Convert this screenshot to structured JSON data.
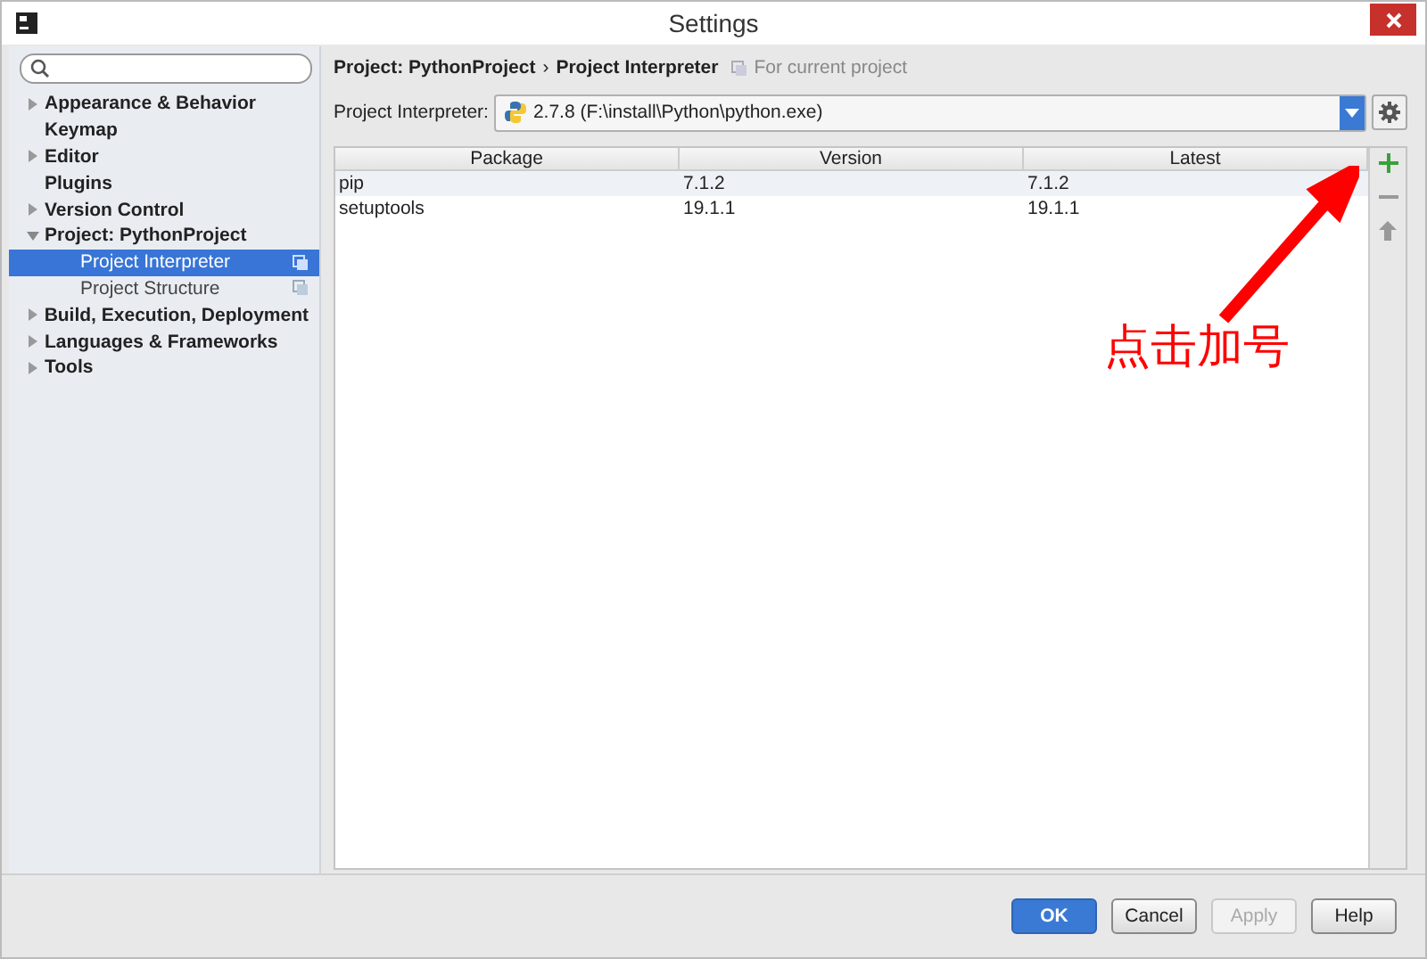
{
  "window": {
    "title": "Settings"
  },
  "sidebar": {
    "items": [
      {
        "label": "Appearance & Behavior",
        "kind": "group",
        "expanded": false,
        "selected": false
      },
      {
        "label": "Keymap",
        "kind": "page",
        "selected": false
      },
      {
        "label": "Editor",
        "kind": "group",
        "expanded": false,
        "selected": false
      },
      {
        "label": "Plugins",
        "kind": "page",
        "selected": false
      },
      {
        "label": "Version Control",
        "kind": "group",
        "expanded": false,
        "selected": false
      },
      {
        "label": "Project: PythonProject",
        "kind": "group",
        "expanded": true,
        "selected": false,
        "children": [
          {
            "label": "Project Interpreter",
            "kind": "page",
            "selected": true
          },
          {
            "label": "Project Structure",
            "kind": "page",
            "selected": false
          }
        ]
      },
      {
        "label": "Build, Execution, Deployment",
        "kind": "group",
        "expanded": false,
        "selected": false
      },
      {
        "label": "Languages & Frameworks",
        "kind": "group",
        "expanded": false,
        "selected": false
      },
      {
        "label": "Tools",
        "kind": "group",
        "expanded": false,
        "selected": false
      }
    ]
  },
  "breadcrumb": {
    "parent": "Project: PythonProject",
    "separator": "›",
    "current": "Project Interpreter",
    "scope": "For current project"
  },
  "interpreter": {
    "label": "Project Interpreter:",
    "value": "2.7.8 (F:\\install\\Python\\python.exe)"
  },
  "table": {
    "columns": [
      "Package",
      "Version",
      "Latest"
    ],
    "rows": [
      {
        "cells": [
          "pip",
          "7.1.2",
          "7.1.2"
        ],
        "selected": true
      },
      {
        "cells": [
          "setuptools",
          "19.1.1",
          "19.1.1"
        ],
        "selected": false
      }
    ]
  },
  "annotation": {
    "text": "点击加号"
  },
  "buttons": [
    {
      "label": "OK",
      "kind": "primary",
      "disabled": false
    },
    {
      "label": "Cancel",
      "kind": "normal",
      "disabled": false
    },
    {
      "label": "Apply",
      "kind": "normal",
      "disabled": true
    },
    {
      "label": "Help",
      "kind": "normal",
      "disabled": false
    }
  ]
}
